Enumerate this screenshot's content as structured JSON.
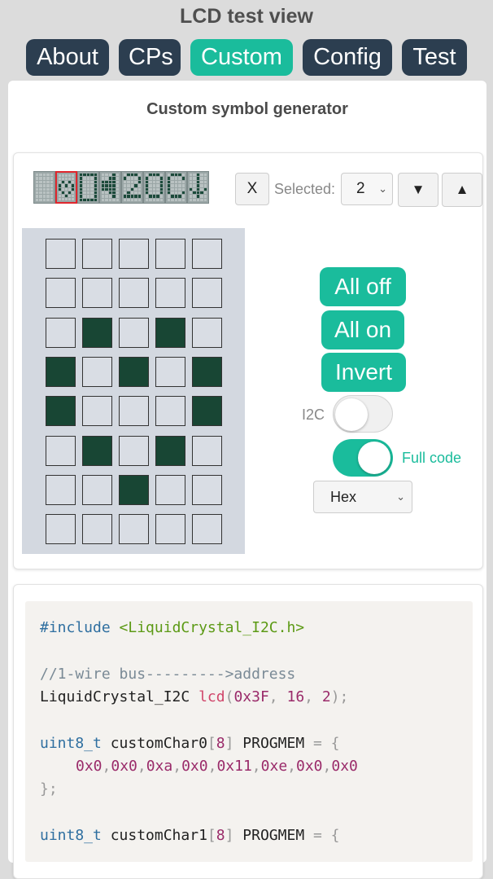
{
  "app": {
    "title": "LCD test view"
  },
  "tabs": [
    {
      "label": "About"
    },
    {
      "label": "CPs"
    },
    {
      "label": "Custom",
      "active": true
    },
    {
      "label": "Config"
    },
    {
      "label": "Test"
    }
  ],
  "panel": {
    "title": "Custom symbol generator"
  },
  "toolbar": {
    "clear_label": "X",
    "selected_label": "Selected:",
    "selected_value": "2",
    "down_label": "▼",
    "up_label": "▲"
  },
  "preview_chars": [
    [
      0,
      0,
      0,
      0,
      0,
      0,
      0,
      0
    ],
    [
      0,
      0,
      10,
      21,
      17,
      10,
      4,
      0
    ],
    [
      31,
      17,
      17,
      17,
      17,
      17,
      17,
      31
    ],
    [
      2,
      6,
      30,
      30,
      30,
      6,
      2,
      0
    ],
    [
      14,
      17,
      1,
      2,
      4,
      8,
      31,
      0
    ],
    [
      14,
      17,
      17,
      17,
      17,
      17,
      14,
      0
    ],
    [
      14,
      17,
      16,
      16,
      16,
      17,
      14,
      0
    ],
    [
      4,
      4,
      4,
      4,
      21,
      14,
      4,
      0
    ]
  ],
  "selected_char_index": 1,
  "editor_rows": [
    [
      0,
      0,
      0,
      0,
      0
    ],
    [
      0,
      0,
      0,
      0,
      0
    ],
    [
      0,
      1,
      0,
      1,
      0
    ],
    [
      1,
      0,
      1,
      0,
      1
    ],
    [
      1,
      0,
      0,
      0,
      1
    ],
    [
      0,
      1,
      0,
      1,
      0
    ],
    [
      0,
      0,
      1,
      0,
      0
    ],
    [
      0,
      0,
      0,
      0,
      0
    ]
  ],
  "actions": {
    "all_off": "All off",
    "all_on": "All on",
    "invert": "Invert"
  },
  "options": {
    "i2c_label": "I2C",
    "i2c_on": false,
    "full_code_label": "Full code",
    "full_code_on": true,
    "format_value": "Hex"
  },
  "code": {
    "include_kw": "#include",
    "include_file": "<LiquidCrystal_I2C.h>",
    "comment": "//1-wire bus--------->address",
    "lcd_type": "LiquidCrystal_I2C",
    "lcd_name": "lcd",
    "lcd_addr": "0x3F",
    "lcd_cols": "16",
    "lcd_rows": "2",
    "type_kw": "uint8_t",
    "char0_name": "customChar0",
    "char1_name": "customChar1",
    "array_size": "8",
    "progmem": "PROGMEM",
    "char0_values": [
      "0x0",
      "0x0",
      "0xa",
      "0x0",
      "0x11",
      "0xe",
      "0x0",
      "0x0"
    ]
  },
  "colors": {
    "accent": "#1abc9c",
    "nav": "#2c3e50",
    "pixel_on": "#184634",
    "selected_outline": "#e0262d"
  }
}
